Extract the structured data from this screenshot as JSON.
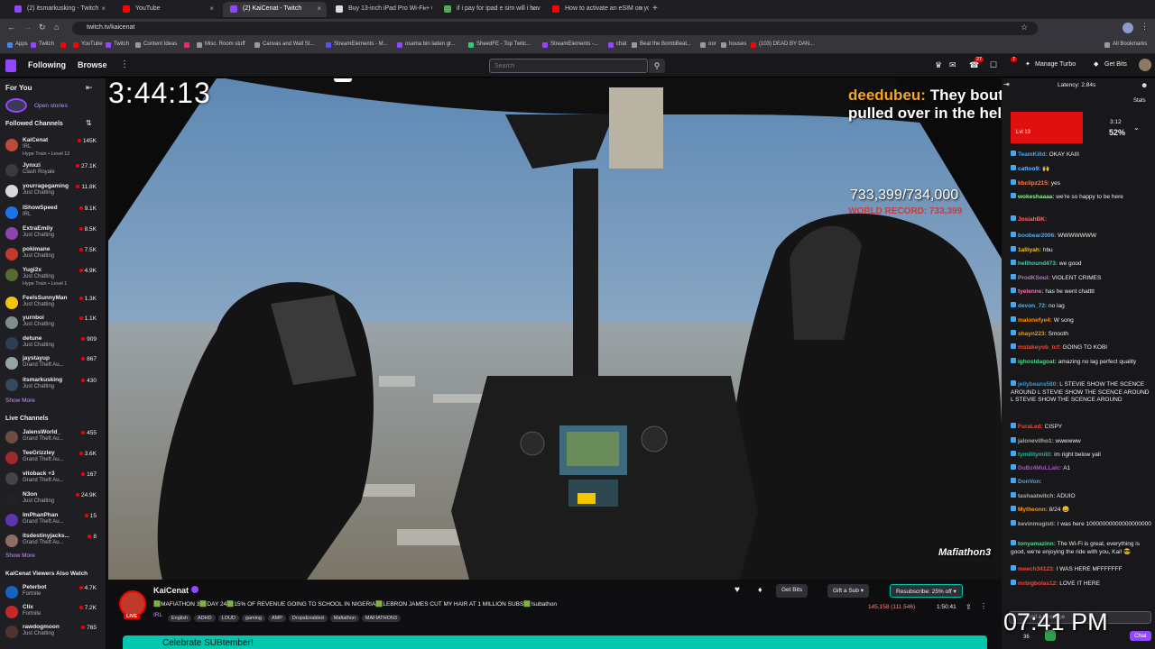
{
  "browser": {
    "tabs": [
      {
        "label": "(2) itsmarkusking - Twitch",
        "color": "#9146ff"
      },
      {
        "label": "YouTube",
        "color": "#ff0000"
      },
      {
        "label": "(2) KaiCenat - Twitch",
        "color": "#9146ff"
      },
      {
        "label": "Buy 13-inch iPad Pro Wi-Fi + C",
        "color": "#dddddd"
      },
      {
        "label": "if i pay for ipad e sim will i hav",
        "color": "#4caf50"
      },
      {
        "label": "How to activate an eSIM on yo",
        "color": "#ff0000"
      }
    ],
    "url": "twitch.tv/kaicenat",
    "bookmarks": [
      {
        "label": "Apps",
        "color": "#4285f4"
      },
      {
        "label": "Twitch",
        "color": "#9146ff"
      },
      {
        "label": "",
        "color": "#ff0000"
      },
      {
        "label": "YouTube",
        "color": "#ff0000"
      },
      {
        "label": "Twitch",
        "color": "#9146ff"
      },
      {
        "label": "Content Ideas",
        "color": "#999999"
      },
      {
        "label": "",
        "color": "#e1306c"
      },
      {
        "label": "Misc. Room stuff",
        "color": "#999999"
      },
      {
        "label": "Canvas and Wall St...",
        "color": "#999999"
      },
      {
        "label": "StreamElements - M...",
        "color": "#5b4cff"
      },
      {
        "label": "osama bin laden gr...",
        "color": "#9146ff"
      },
      {
        "label": "SheedFE - Top Twitc...",
        "color": "#2ecc71"
      },
      {
        "label": "StreamElements -...",
        "color": "#9146ff"
      },
      {
        "label": "chat",
        "color": "#9146ff"
      },
      {
        "label": "Beat the BombBeat...",
        "color": "#999999"
      },
      {
        "label": "oor",
        "color": "#999999"
      },
      {
        "label": "houses",
        "color": "#999999"
      },
      {
        "label": "(103) DEAD BY DAN...",
        "color": "#ff0000"
      }
    ],
    "all_bookmarks": "All Bookmarks"
  },
  "topnav": {
    "following": "Following",
    "browse": "Browse",
    "search_placeholder": "Search",
    "badge_notif": "27",
    "badge_inbox": "7",
    "manage_turbo": "Manage Turbo",
    "get_bits": "Get Bits"
  },
  "sidebar": {
    "for_you": "For You",
    "open_stories": "Open stories",
    "followed_title": "Followed Channels",
    "followed": [
      {
        "name": "KaiCenat",
        "game": "IRL",
        "viewers": "145K",
        "extra": "Hype Train • Level 12",
        "color": "#b84b3a"
      },
      {
        "name": "Jynxzi",
        "game": "Clash Royale",
        "viewers": "27.1K",
        "extra": "",
        "color": "#3a3a3a"
      },
      {
        "name": "yourragegaming",
        "game": "Just Chatting",
        "viewers": "11.8K",
        "extra": "",
        "color": "#d9d9d9"
      },
      {
        "name": "IShowSpeed",
        "game": "IRL",
        "viewers": "9.1K",
        "extra": "",
        "color": "#1a73e8"
      },
      {
        "name": "ExtraEmily",
        "game": "Just Chatting",
        "viewers": "8.5K",
        "extra": "",
        "color": "#8e44ad"
      },
      {
        "name": "pokimane",
        "game": "Just Chatting",
        "viewers": "7.5K",
        "extra": "",
        "color": "#c0392b"
      },
      {
        "name": "Yugi2x",
        "game": "Just Chatting",
        "viewers": "4.9K",
        "extra": "Hype Train • Level 1",
        "color": "#556b2f"
      },
      {
        "name": "FeelsSunnyMan",
        "game": "Just Chatting",
        "viewers": "1.3K",
        "extra": "",
        "color": "#f1c40f"
      },
      {
        "name": "yurnboi",
        "game": "Just Chatting",
        "viewers": "1.1K",
        "extra": "",
        "color": "#7f8c8d"
      },
      {
        "name": "detune",
        "game": "Just Chatting",
        "viewers": "909",
        "extra": "",
        "color": "#2c3e50"
      },
      {
        "name": "jaystayup",
        "game": "Grand Theft Au...",
        "viewers": "867",
        "extra": "",
        "color": "#95a5a6"
      },
      {
        "name": "itsmarkusking",
        "game": "Just Chatting",
        "viewers": "430",
        "extra": "",
        "color": "#34495e"
      }
    ],
    "show_more_1": "Show More",
    "live_title": "Live Channels",
    "live": [
      {
        "name": "JalensWorld_",
        "game": "Grand Theft Au...",
        "viewers": "455",
        "color": "#6d4c41"
      },
      {
        "name": "TeeGrizzley",
        "game": "Grand Theft Au...",
        "viewers": "3.6K",
        "color": "#9e2a2b"
      },
      {
        "name": "vitoback +3",
        "game": "Grand Theft Au...",
        "viewers": "167",
        "color": "#444444"
      },
      {
        "name": "N3on",
        "game": "Just Chatting",
        "viewers": "24.9K",
        "color": "#222222"
      },
      {
        "name": "ImPhanPhan",
        "game": "Grand Theft Au...",
        "viewers": "15",
        "color": "#5e35b1"
      },
      {
        "name": "itsdestinyjacks...",
        "game": "Grand Theft Au...",
        "viewers": "8",
        "color": "#8d6e63"
      }
    ],
    "show_more_2": "Show More",
    "also_title": "KaiCenat Viewers Also Watch",
    "also": [
      {
        "name": "Peterbot",
        "game": "Fortnite",
        "viewers": "4.7K",
        "color": "#1565c0"
      },
      {
        "name": "Clix",
        "game": "Fortnite",
        "viewers": "7.2K",
        "color": "#c62828"
      },
      {
        "name": "rawdogmoon",
        "game": "Just Chatting",
        "viewers": "765",
        "color": "#4e342e"
      }
    ]
  },
  "video": {
    "timer": "3:44:13",
    "vj_logo": "VJ",
    "alert_user": "deedubeu:",
    "alert_text_1": "They bouta get",
    "alert_text_2": "pulled over in the",
    "alert_text_3": "helli",
    "sub_count": "733,399/734,000",
    "world_record": "WORLD RECORD: 733,399",
    "watermark": "Mafiathon3",
    "poll_label": "Lvl 13",
    "poll_time": "3:12",
    "poll_percent": "52%",
    "latency": "Latency: 2.84s",
    "stats_label": "Stats"
  },
  "chat": {
    "messages": [
      {
        "user": "TeamKilld:",
        "text": "OKAY KAIII",
        "color": "#3fa9f5"
      },
      {
        "user": "cattoo9:",
        "text": "🙌",
        "color": "#6ab7ff"
      },
      {
        "user": "kbclipz215:",
        "text": "yes",
        "color": "#ff7f50"
      },
      {
        "user": "wokeshaaaa:",
        "text": "we're so happy to be here",
        "color": "#7fff7f"
      },
      {
        "user": "JosiahBK:",
        "text": "",
        "color": "#ff6b6b"
      },
      {
        "user": "boobear2006:",
        "text": "WWWWWWW",
        "color": "#5dade2"
      },
      {
        "user": "1alliyah:",
        "text": "hbu",
        "color": "#f1c40f"
      },
      {
        "user": "hellhound473:",
        "text": "we good",
        "color": "#48c9b0"
      },
      {
        "user": "ProdKSoul:",
        "text": "VIOLENT CRIMES",
        "color": "#af7ac5"
      },
      {
        "user": "tyelenne:",
        "text": "has he went chatttt",
        "color": "#ff69b4"
      },
      {
        "user": "devon_72:",
        "text": "no lag",
        "color": "#5dade2"
      },
      {
        "user": "malonefye4:",
        "text": "W song",
        "color": "#ff8c00"
      },
      {
        "user": "shayn223:",
        "text": "Smooth",
        "color": "#daa520"
      },
      {
        "user": "mstakeyob_tcf:",
        "text": "GOING TO KOBI",
        "color": "#e74c3c"
      },
      {
        "user": "ighostdagoat:",
        "text": "amazing no lag perfect quality",
        "color": "#58d68d"
      },
      {
        "user": "jellybeans580:",
        "text": "L STEVIE SHOW THE SCENCE AROUND L STEVIE SHOW THE SCENCE AROUND L STEVIE SHOW THE SCENCE AROUND",
        "color": "#3498db"
      },
      {
        "user": "FuraLed:",
        "text": "CISPY",
        "color": "#e74c3c"
      },
      {
        "user": "jalonevilho1:",
        "text": "wwwwww",
        "color": "#aaaaaa"
      },
      {
        "user": "tymilitymilit:",
        "text": "im right below yall",
        "color": "#1abc9c"
      },
      {
        "user": "DuBz4MuLLaIc:",
        "text": "A1",
        "color": "#9b59b6"
      },
      {
        "user": "DonVon:",
        "text": "",
        "color": "#3fa9f5"
      },
      {
        "user": "tashaatwitch:",
        "text": "ADUIO",
        "color": "#aaaaaa"
      },
      {
        "user": "Mytheonn:",
        "text": "8/24 😀",
        "color": "#f39c12"
      },
      {
        "user": "kevinmugisti:",
        "text": "I was here 10000000000000000000",
        "color": "#aaaaaa"
      },
      {
        "user": "tonyamazinn:",
        "text": "The Wi-Fi is great, everything is good, we're enjoying the ride with you, Kai! 😎",
        "color": "#58d68d"
      },
      {
        "user": "meech34123:",
        "text": "I WAS HERE MFFFFFFF",
        "color": "#e74c3c"
      },
      {
        "user": "mrbigbolas12:",
        "text": "LOVE IT HERE",
        "color": "#e74c3c"
      }
    ],
    "input_placeholder": "Send a message",
    "points": "36",
    "chat_button": "Chat",
    "clock": "07:41 PM"
  },
  "info": {
    "streamer": "KaiCenat",
    "live_label": "LIVE",
    "title": "🟩MAFIATHON 3🟩DAY 24🟩15% OF REVENUE GOING TO SCHOOL IN NIGERIA🟩LEBRON JAMES CUT MY HAIR AT 1 MILLION SUBS🟩!subathon",
    "category": "IRL",
    "tags": [
      "English",
      "ADHD",
      "LOUD",
      "gaming",
      "AMP",
      "DropsEnabled",
      "Mafiathon",
      "MAFIATHON3"
    ],
    "get_bits": "Get Bits",
    "gift_sub": "Gift a Sub",
    "resubscribe": "Resubscribe: 25% off",
    "viewers": "145,158 (111 546)",
    "uptime": "1:50:41",
    "banner": "Celebrate SUBtember!"
  }
}
